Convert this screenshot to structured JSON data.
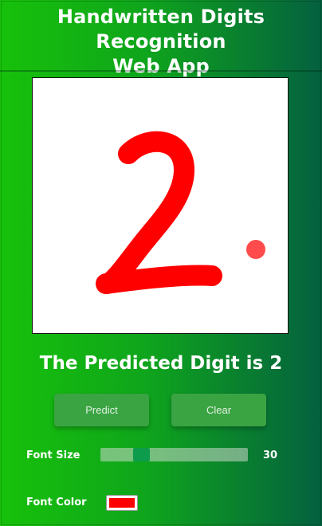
{
  "header": {
    "title_line1": "Handwritten Digits Recognition",
    "title_line2": "Web App"
  },
  "result": {
    "text": "The Predicted Digit is 2"
  },
  "buttons": {
    "predict_label": "Predict",
    "clear_label": "Clear"
  },
  "controls": {
    "font_size_label": "Font Size",
    "font_size_value": "30",
    "font_size_fraction": 0.25,
    "font_color_label": "Font Color",
    "font_color": "#ff0000"
  },
  "colors": {
    "background_start": "#17c10a",
    "background_end": "#04603f",
    "button": "#3aa443",
    "slider_thumb": "#0d9b4c",
    "stroke": "#ff0000",
    "cursor_dot": "#ff4b4b"
  }
}
